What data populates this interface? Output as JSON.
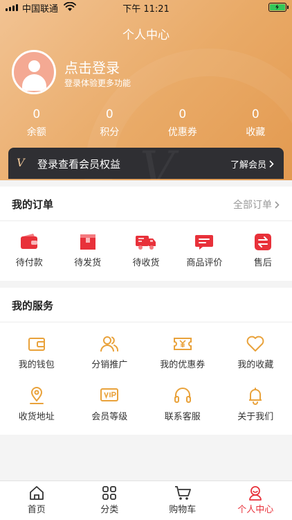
{
  "status_bar": {
    "carrier": "中国联通",
    "time": "下午 11:21"
  },
  "header": {
    "title": "个人中心",
    "login_title": "点击登录",
    "login_subtitle": "登录体验更多功能"
  },
  "stats": [
    {
      "value": "0",
      "label": "余额"
    },
    {
      "value": "0",
      "label": "积分"
    },
    {
      "value": "0",
      "label": "优惠券"
    },
    {
      "value": "0",
      "label": "收藏"
    }
  ],
  "member": {
    "text": "登录查看会员权益",
    "link": "了解会员",
    "mark": "V"
  },
  "orders": {
    "title": "我的订单",
    "all_link": "全部订单",
    "items": [
      {
        "label": "待付款",
        "icon": "wallet-icon"
      },
      {
        "label": "待发货",
        "icon": "package-icon"
      },
      {
        "label": "待收货",
        "icon": "truck-icon"
      },
      {
        "label": "商品评价",
        "icon": "comment-icon"
      },
      {
        "label": "售后",
        "icon": "exchange-icon"
      }
    ]
  },
  "services": {
    "title": "我的服务",
    "items": [
      {
        "label": "我的钱包",
        "icon": "wallet-outline-icon"
      },
      {
        "label": "分销推广",
        "icon": "users-icon"
      },
      {
        "label": "我的优惠券",
        "icon": "coupon-icon"
      },
      {
        "label": "我的收藏",
        "icon": "heart-icon"
      },
      {
        "label": "收货地址",
        "icon": "location-icon"
      },
      {
        "label": "会员等级",
        "icon": "vip-icon"
      },
      {
        "label": "联系客服",
        "icon": "headset-icon"
      },
      {
        "label": "关于我们",
        "icon": "bell-icon"
      }
    ]
  },
  "tabbar": {
    "active_index": 3,
    "items": [
      {
        "label": "首页",
        "icon": "home-icon"
      },
      {
        "label": "分类",
        "icon": "grid-icon"
      },
      {
        "label": "购物车",
        "icon": "cart-icon"
      },
      {
        "label": "个人中心",
        "icon": "profile-icon"
      }
    ]
  },
  "colors": {
    "accent_red": "#e8313a",
    "service_orange": "#e9a23b",
    "header_gradient_start": "#f2c393",
    "header_gradient_end": "#e39a50",
    "member_bar": "#2f2f33"
  }
}
